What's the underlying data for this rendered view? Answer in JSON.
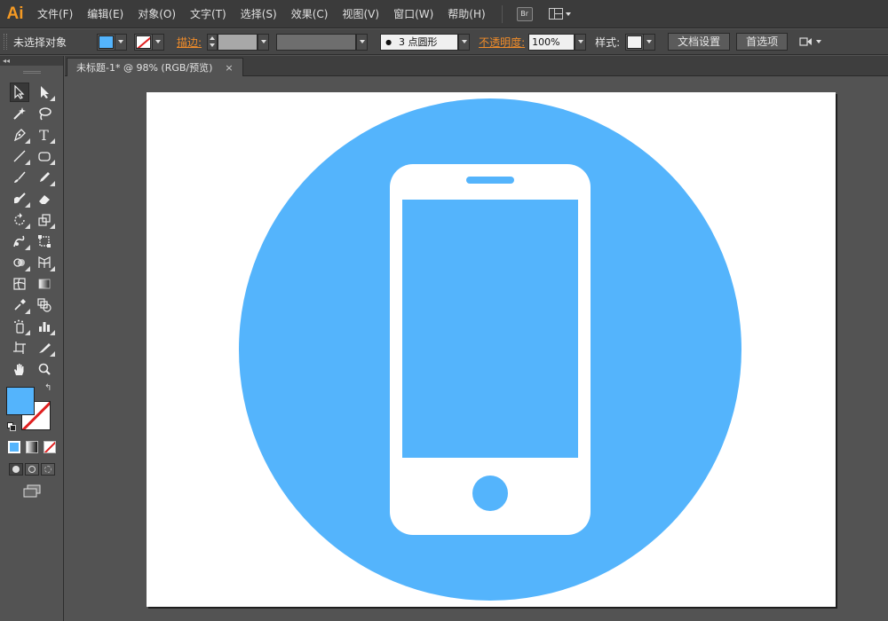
{
  "app": {
    "logo": "Ai"
  },
  "menu": [
    "文件(F)",
    "编辑(E)",
    "对象(O)",
    "文字(T)",
    "选择(S)",
    "效果(C)",
    "视图(V)",
    "窗口(W)",
    "帮助(H)"
  ],
  "bridge_label": "Br",
  "control": {
    "selection_label": "未选择对象",
    "stroke_label": "描边:",
    "brush_value": "3 点圆形",
    "opacity_label": "不透明度:",
    "opacity_value": "100%",
    "style_label": "样式:",
    "doc_setup_button": "文档设置",
    "prefs_button": "首选项"
  },
  "colors": {
    "fill": "#54b4fc",
    "artboard": "#ffffff",
    "icon": "#ffffff",
    "accent": "#f08c2a"
  },
  "document": {
    "tab_title": "未标题-1* @ 98% (RGB/预览)",
    "close_glyph": "×"
  },
  "tools": [
    [
      "selection-tool",
      "direct-selection-tool"
    ],
    [
      "magic-wand-tool",
      "lasso-tool"
    ],
    [
      "pen-tool",
      "type-tool"
    ],
    [
      "line-tool",
      "rectangle-tool"
    ],
    [
      "paintbrush-tool",
      "pencil-tool"
    ],
    [
      "blob-brush-tool",
      "eraser-tool"
    ],
    [
      "rotate-tool",
      "scale-tool"
    ],
    [
      "warp-tool",
      "free-transform-tool"
    ],
    [
      "shape-builder-tool",
      "perspective-grid-tool"
    ],
    [
      "mesh-tool",
      "gradient-tool"
    ],
    [
      "eyedropper-tool",
      "blend-tool"
    ],
    [
      "symbol-sprayer-tool",
      "column-graph-tool"
    ],
    [
      "artboard-tool",
      "slice-tool"
    ],
    [
      "hand-tool",
      "zoom-tool"
    ]
  ],
  "type_tool_glyph": "T"
}
